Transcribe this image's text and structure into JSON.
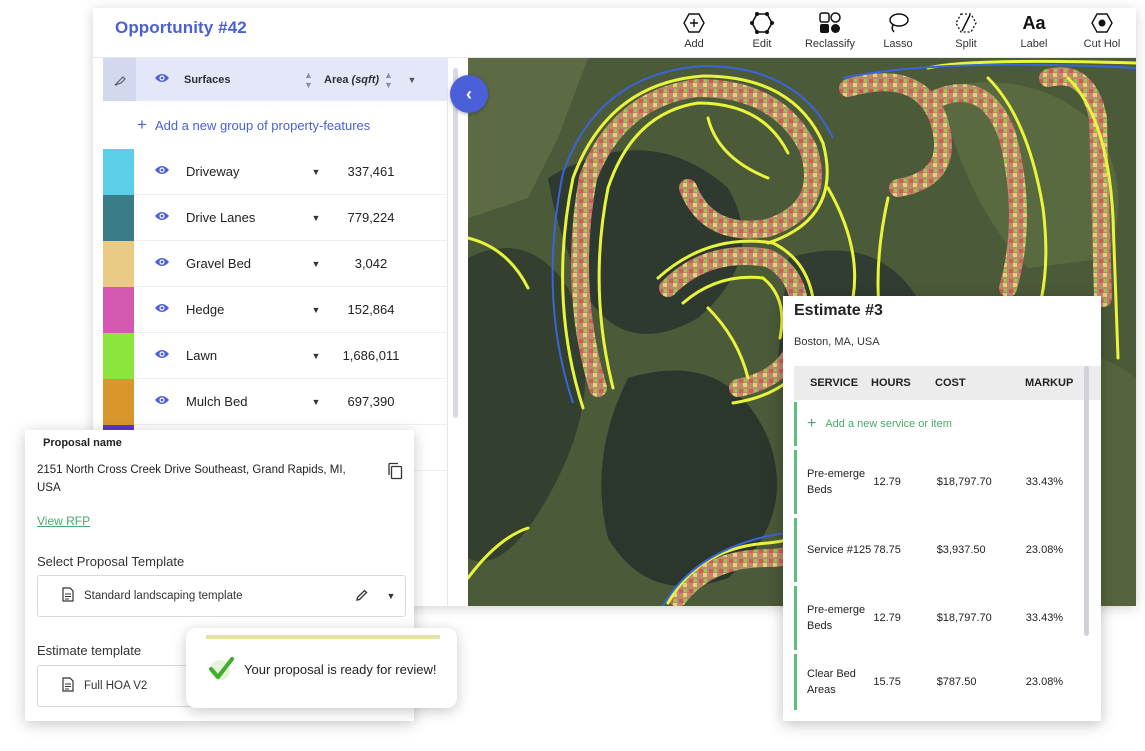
{
  "app": {
    "title": "Opportunity #42"
  },
  "toolbar": [
    {
      "label": "Add",
      "icon": "add-icon"
    },
    {
      "label": "Edit",
      "icon": "edit-icon"
    },
    {
      "label": "Reclassify",
      "icon": "reclassify-icon"
    },
    {
      "label": "Lasso",
      "icon": "lasso-icon"
    },
    {
      "label": "Split",
      "icon": "split-icon"
    },
    {
      "label": "Label",
      "icon": "label-icon",
      "glyph": "Aa"
    },
    {
      "label": "Cut Hol",
      "icon": "cut-hole-icon"
    }
  ],
  "panel": {
    "header": {
      "surfaces": "Surfaces",
      "area_prefix": "Area",
      "area_unit": "(sqft)"
    },
    "add_group": "Add a new group of property-features",
    "features": [
      {
        "name": "Driveway",
        "value": "337,461",
        "color": "#5bcfe8"
      },
      {
        "name": "Drive Lanes",
        "value": "779,224",
        "color": "#3a7c87"
      },
      {
        "name": "Gravel Bed",
        "value": "3,042",
        "color": "#eacb86"
      },
      {
        "name": "Hedge",
        "value": "152,864",
        "color": "#d35ab0"
      },
      {
        "name": "Lawn",
        "value": "1,686,011",
        "color": "#8be53c"
      },
      {
        "name": "Mulch Bed",
        "value": "697,390",
        "color": "#d9962c"
      }
    ]
  },
  "estimate": {
    "title": "Estimate #3",
    "location": "Boston, MA, USA",
    "columns": [
      "SERVICE",
      "HOURS",
      "COST",
      "MARKUP"
    ],
    "add_label": "Add a new service or item",
    "rows": [
      {
        "service": "Pre-emerge Beds",
        "hours": "12.79",
        "cost": "$18,797.70",
        "markup": "33.43%"
      },
      {
        "service": "Service #125",
        "hours": "78.75",
        "cost": "$3,937.50",
        "markup": "23.08%"
      },
      {
        "service": "Pre-emerge Beds",
        "hours": "12.79",
        "cost": "$18,797.70",
        "markup": "33.43%"
      },
      {
        "service": "Clear Bed Areas",
        "hours": "15.75",
        "cost": "$787.50",
        "markup": "23.08%"
      }
    ]
  },
  "proposal": {
    "name_label": "Proposal name",
    "address": "2151 North Cross Creek Drive Southeast, Grand Rapids, MI, USA",
    "view_rfp": "View RFP",
    "template_label": "Select Proposal Template",
    "template_value": "Standard landscaping template",
    "estimate_label": "Estimate template",
    "estimate_value": "Full HOA V2"
  },
  "toast": {
    "message": "Your proposal is ready for review!"
  },
  "colors": {
    "accent": "#4a5fd8",
    "success": "#4aa86a",
    "map_yellow": "#e8f53a"
  }
}
